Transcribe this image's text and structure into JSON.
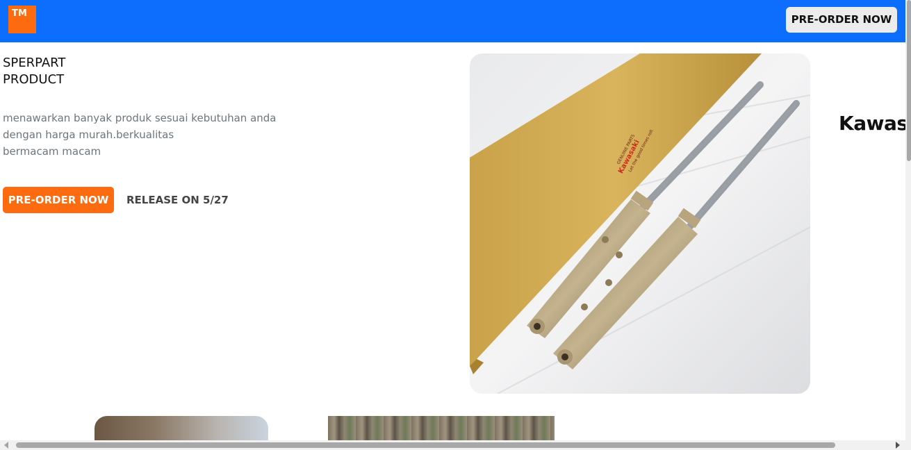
{
  "header": {
    "logo_text": "TM",
    "cta_label": "PRE-ORDER NOW",
    "bg_color": "#0d6efd",
    "logo_color": "#fd6b10"
  },
  "hero": {
    "title": "SPERPART\nPRODUCT",
    "description": "menawarkan banyak produk sesuai kebutuhan anda\ndengan harga murah.berkualitas\nbermacam macam",
    "cta_label": "PRE-ORDER NOW",
    "release_text": "RELEASE ON 5/27",
    "image_icon": "front-fork-product-photo",
    "box_label_1": "GENUINE PARTS",
    "box_label_2": "Kawasaki",
    "box_label_3": "Let the good times roll."
  },
  "brand": {
    "logo_icon": "kawasaki-river-mark-icon",
    "text": "Kawasaki"
  },
  "thumbnails": [
    {
      "icon": "product-thumbnail-1"
    },
    {
      "icon": "product-thumbnail-2"
    }
  ]
}
